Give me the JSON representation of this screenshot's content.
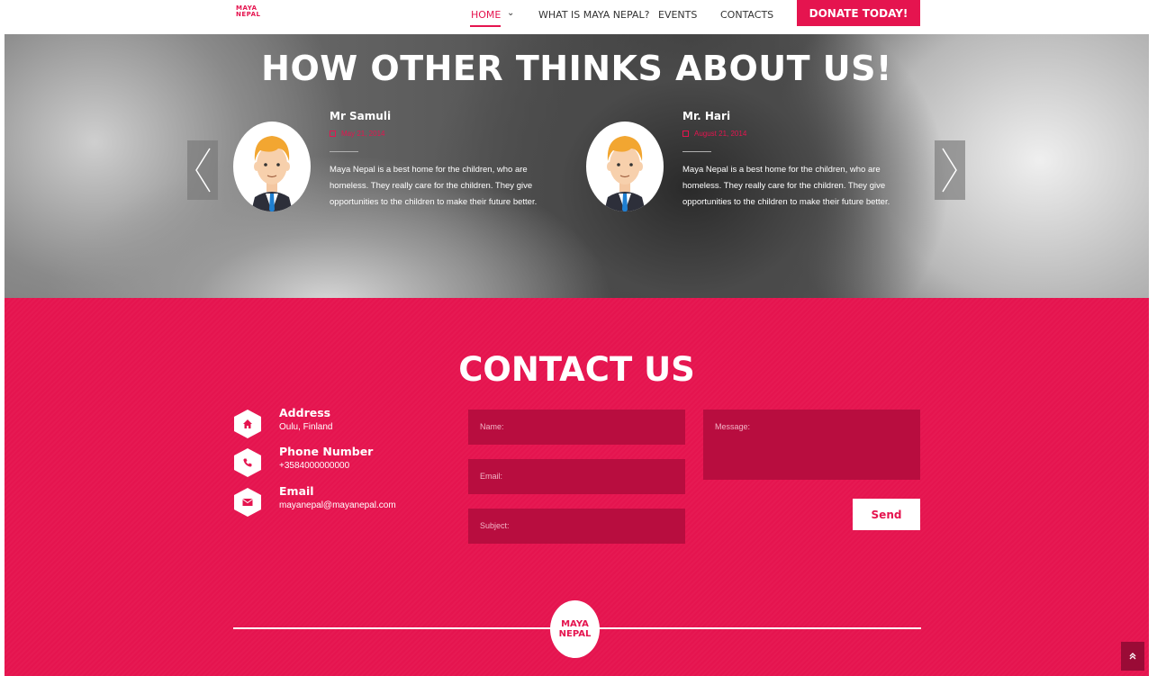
{
  "header": {
    "logo_line1": "MAYA",
    "logo_line2": "NEPAL",
    "nav": {
      "home": "HOME",
      "what": "WHAT IS MAYA NEPAL?",
      "events": "EVENTS",
      "contacts": "CONTACTS"
    },
    "donate_label": "DONATE TODAY!"
  },
  "testimonials": {
    "title": "HOW OTHER THINKS ABOUT US!",
    "items": [
      {
        "name": "Mr Samuli",
        "date": "May 21, 2014",
        "text": "Maya Nepal is a best home for the children, who are homeless. They really care for the children. They give opportunities to the children to make their future better."
      },
      {
        "name": "Mr. Hari",
        "date": "August 21, 2014",
        "text": "Maya Nepal is a best home for the children, who are homeless. They really care for the children. They give opportunities to the children to make their future better."
      }
    ]
  },
  "contact": {
    "title": "CONTACT US",
    "address_label": "Address",
    "address_value": "Oulu, Finland",
    "phone_label": "Phone Number",
    "phone_value": "+3584000000000",
    "email_label": "Email",
    "email_value": "mayanepal@mayanepal.com",
    "form": {
      "name_placeholder": "Name:",
      "email_placeholder": "Email:",
      "subject_placeholder": "Subject:",
      "message_placeholder": "Message:",
      "send_label": "Send"
    }
  },
  "footer": {
    "logo_line1": "MAYA",
    "logo_line2": "NEPAL"
  },
  "colors": {
    "accent": "#e5144f",
    "field_bg": "#b80d3f"
  }
}
